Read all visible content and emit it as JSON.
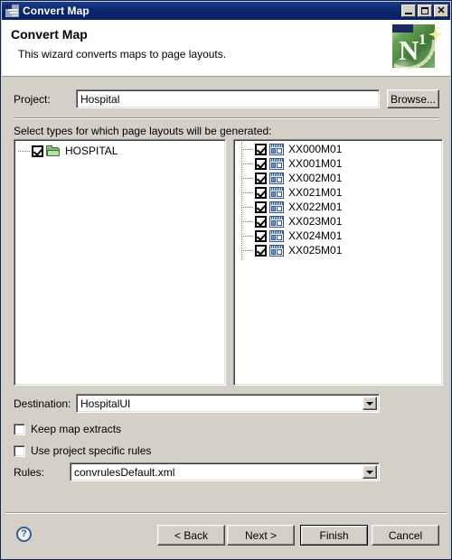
{
  "window": {
    "title": "Convert Map",
    "icon": "map-document-icon",
    "controls": {
      "minimize": "minimize-button",
      "maximize": "maximize-button",
      "close_label": "✕"
    }
  },
  "header": {
    "title": "Convert Map",
    "subtitle": "This wizard converts maps to page layouts.",
    "logo": {
      "name": "n1-logo",
      "letter": "N",
      "superscript": "1",
      "color": "#3f7a33"
    }
  },
  "project": {
    "label": "Project:",
    "value": "Hospital",
    "placeholder": "",
    "browse_label": "Browse..."
  },
  "selection": {
    "instruction": "Select types for which page layouts will be generated:",
    "tree": {
      "nodes": [
        {
          "label": "HOSPITAL",
          "checked": true,
          "icon": "folder-icon"
        }
      ]
    },
    "list": {
      "items": [
        {
          "label": "XX000M01",
          "checked": true,
          "icon": "page-layout-icon"
        },
        {
          "label": "XX001M01",
          "checked": true,
          "icon": "page-layout-icon"
        },
        {
          "label": "XX002M01",
          "checked": true,
          "icon": "page-layout-icon"
        },
        {
          "label": "XX021M01",
          "checked": true,
          "icon": "page-layout-icon"
        },
        {
          "label": "XX022M01",
          "checked": true,
          "icon": "page-layout-icon"
        },
        {
          "label": "XX023M01",
          "checked": true,
          "icon": "page-layout-icon"
        },
        {
          "label": "XX024M01",
          "checked": true,
          "icon": "page-layout-icon"
        },
        {
          "label": "XX025M01",
          "checked": true,
          "icon": "page-layout-icon"
        }
      ]
    }
  },
  "destination": {
    "label": "Destination:",
    "value": "HospitalUI"
  },
  "options": {
    "keep_map_extracts": {
      "label": "Keep map extracts",
      "checked": false
    },
    "use_project_specific_rules": {
      "label": "Use project specific rules",
      "checked": false
    }
  },
  "rules": {
    "label": "Rules:",
    "value": "convrulesDefault.xml"
  },
  "footer": {
    "help_label": "?",
    "back_label": "< Back",
    "next_label": "Next >",
    "finish_label": "Finish",
    "cancel_label": "Cancel"
  },
  "colors": {
    "titlebar": "#0a246a",
    "dialog_face": "#d4d0c8",
    "header_bg": "#ffffff",
    "field_bg": "#ffffff",
    "accent_green": "#3f7a33",
    "icon_blue": "#2e5596"
  }
}
